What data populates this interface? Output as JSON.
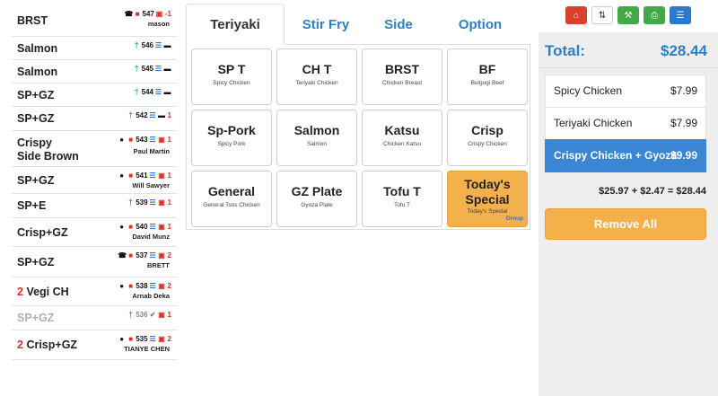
{
  "orders": [
    {
      "qty": "",
      "name": "BRST",
      "name2": "",
      "icons": [
        "phone",
        "bag"
      ],
      "number": "547",
      "extra_icons": [
        "bell"
      ],
      "count": "-1",
      "customer": "mason",
      "dim": false
    },
    {
      "qty": "",
      "name": "Salmon",
      "name2": "",
      "icons": [
        "walk"
      ],
      "number": "546",
      "extra_icons": [
        "list",
        "card"
      ],
      "count": "",
      "customer": "",
      "dim": false
    },
    {
      "qty": "",
      "name": "Salmon",
      "name2": "",
      "icons": [
        "walk"
      ],
      "number": "545",
      "extra_icons": [
        "list",
        "card"
      ],
      "count": "",
      "customer": "",
      "dim": false
    },
    {
      "qty": "",
      "name": "SP+GZ",
      "name2": "",
      "icons": [
        "walk"
      ],
      "number": "544",
      "extra_icons": [
        "list",
        "card"
      ],
      "count": "",
      "customer": "",
      "dim": false
    },
    {
      "qty": "",
      "name": "SP+GZ",
      "name2": "",
      "icons": [
        "walk"
      ],
      "number": "542",
      "extra_icons": [
        "list",
        "card"
      ],
      "count": "1",
      "customer": "",
      "dim": false
    },
    {
      "qty": "",
      "name": "Crispy",
      "name2": "Side Brown",
      "icons": [
        "globe",
        "bag"
      ],
      "number": "543",
      "extra_icons": [
        "list",
        "bell"
      ],
      "count": "1",
      "customer": "Paul Martin",
      "dim": false
    },
    {
      "qty": "",
      "name": "SP+GZ",
      "name2": "",
      "icons": [
        "globe",
        "bag"
      ],
      "number": "541",
      "extra_icons": [
        "list",
        "bell"
      ],
      "count": "1",
      "customer": "Will Sawyer",
      "dim": false
    },
    {
      "qty": "",
      "name": "SP+E",
      "name2": "",
      "icons": [
        "walk"
      ],
      "number": "539",
      "extra_icons": [
        "list",
        "bell"
      ],
      "count": "1",
      "customer": "",
      "dim": false
    },
    {
      "qty": "",
      "name": "Crisp+GZ",
      "name2": "",
      "icons": [
        "globe",
        "bag"
      ],
      "number": "540",
      "extra_icons": [
        "list",
        "bell"
      ],
      "count": "1",
      "customer": "David Munz",
      "dim": false
    },
    {
      "qty": "",
      "name": "SP+GZ",
      "name2": "",
      "icons": [
        "phone",
        "bag"
      ],
      "number": "537",
      "extra_icons": [
        "list",
        "bell"
      ],
      "count": "2",
      "customer": "BRETT",
      "dim": false
    },
    {
      "qty": "2",
      "name": "Vegi CH",
      "name2": "",
      "icons": [
        "globe",
        "bag"
      ],
      "number": "538",
      "extra_icons": [
        "list",
        "bell"
      ],
      "count": "2",
      "customer": "Arnab Deka",
      "dim": false
    },
    {
      "qty": "",
      "name": "SP+GZ",
      "name2": "",
      "icons": [
        "walk"
      ],
      "number": "536",
      "extra_icons": [
        "check",
        "bell"
      ],
      "count": "1",
      "customer": "",
      "dim": true
    },
    {
      "qty": "2",
      "name": "Crisp+GZ",
      "name2": "",
      "icons": [
        "globe",
        "bag"
      ],
      "number": "535",
      "extra_icons": [
        "list",
        "bell"
      ],
      "count": "2",
      "customer": "TIANYE CHEN",
      "dim": false
    }
  ],
  "tabs": [
    {
      "label": "Teriyaki",
      "active": true
    },
    {
      "label": "Stir Fry",
      "active": false
    },
    {
      "label": "Side",
      "active": false
    },
    {
      "label": "Option",
      "active": false
    }
  ],
  "menu_items": [
    {
      "code": "SP T",
      "desc": "Spicy Chicken",
      "special": false
    },
    {
      "code": "CH T",
      "desc": "Teriyaki Chicken",
      "special": false
    },
    {
      "code": "BRST",
      "desc": "Chicken Breast",
      "special": false
    },
    {
      "code": "BF",
      "desc": "Bulgogi Beef",
      "special": false
    },
    {
      "code": "Sp-Pork",
      "desc": "Spicy Pork",
      "special": false
    },
    {
      "code": "Salmon",
      "desc": "Salmon",
      "special": false
    },
    {
      "code": "Katsu",
      "desc": "Chicken Katsu",
      "special": false
    },
    {
      "code": "Crisp",
      "desc": "Crispy Chicken",
      "special": false
    },
    {
      "code": "General",
      "desc": "General Tsos Chicken",
      "special": false
    },
    {
      "code": "GZ Plate",
      "desc": "Gyoza Plate",
      "special": false
    },
    {
      "code": "Tofu T",
      "desc": "Tofu T",
      "special": false
    },
    {
      "code": "Today's Special",
      "desc": "Today's Special",
      "special": true,
      "group": "Group"
    }
  ],
  "toolbar": {
    "home_icon": "home-icon",
    "sort_icon": "sort-icon",
    "wrench_icon": "wrench-icon",
    "print_icon": "print-icon",
    "list_icon": "list-icon"
  },
  "checkout": {
    "total_label": "Total:",
    "total_value": "$28.44",
    "items": [
      {
        "name": "Spicy Chicken",
        "price": "$7.99",
        "selected": false
      },
      {
        "name": "Teriyaki Chicken",
        "price": "$7.99",
        "selected": false
      },
      {
        "name": "Crispy Chicken + Gyoza",
        "price": "$9.99",
        "selected": true
      }
    ],
    "summary": "$25.97 + $2.47 = $28.44",
    "remove_label": "Remove All"
  },
  "colors": {
    "accent_blue": "#2c7fc9",
    "special_orange": "#f4b04a",
    "alert_red": "#d9302c",
    "walkin_green": "#2fb34a"
  }
}
